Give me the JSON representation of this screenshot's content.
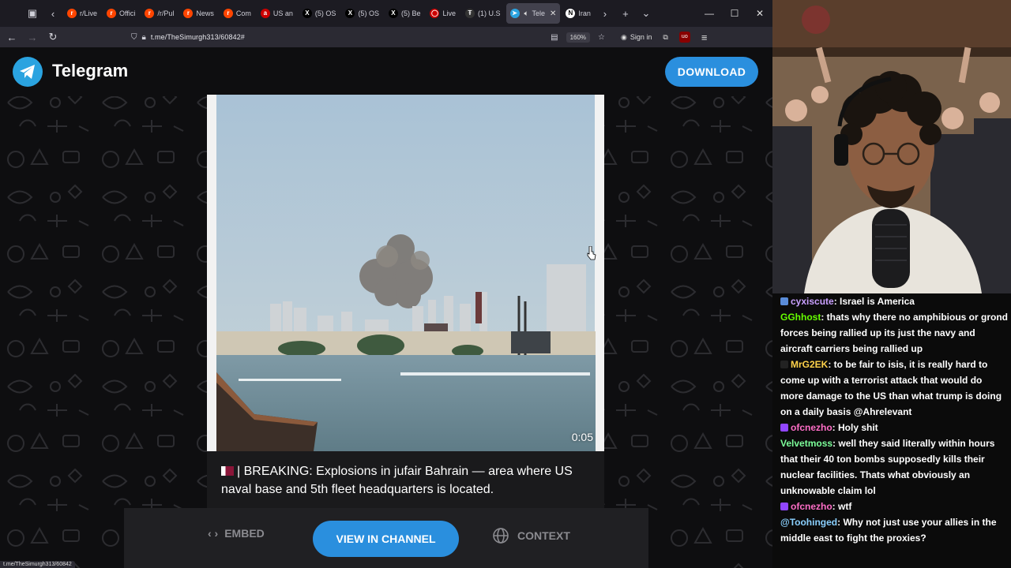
{
  "browser": {
    "tabs": [
      {
        "label": "r/Live",
        "color": "#ff4500",
        "glyph": "r"
      },
      {
        "label": "Offici",
        "color": "#ff4500",
        "glyph": "r"
      },
      {
        "label": "/r/Pul",
        "color": "#ff4500",
        "glyph": "r"
      },
      {
        "label": "News",
        "color": "#ff4500",
        "glyph": "r"
      },
      {
        "label": "Com",
        "color": "#ff4500",
        "glyph": "r"
      },
      {
        "label": "US an",
        "color": "#cc0000",
        "glyph": "a"
      },
      {
        "label": "(5) OS",
        "color": "#000000",
        "glyph": "X"
      },
      {
        "label": "(5) OS",
        "color": "#000000",
        "glyph": "X"
      },
      {
        "label": "(5) Be",
        "color": "#000000",
        "glyph": "X"
      },
      {
        "label": "Live",
        "color": "#cc0000",
        "glyph": "◯"
      },
      {
        "label": "(1) U.S",
        "color": "#333333",
        "glyph": "Ŧ"
      },
      {
        "label": "Tele",
        "color": "#2aa3e0",
        "glyph": "➤",
        "active": true
      },
      {
        "label": "Iran",
        "color": "#ffffff",
        "glyph": "N"
      }
    ],
    "url": "t.me/TheSimurgh313/60842#",
    "zoom": "160%",
    "sign_in": "Sign in",
    "status_url": "t.me/TheSimurgh313/60842"
  },
  "telegram": {
    "title": "Telegram",
    "download_label": "DOWNLOAD",
    "video_duration": "0:05",
    "post_text": "| BREAKING: Explosions in jufair Bahrain — area where US naval base and 5th fleet headquarters is located.",
    "embed_label": "EMBED",
    "view_channel_label": "VIEW IN CHANNEL",
    "context_label": "CONTEXT"
  },
  "chat": {
    "messages": [
      {
        "user": "cyxiscute",
        "color": "#c9a0ff",
        "badge": "#5a8cd8",
        "text": ": Israel is America"
      },
      {
        "user": "GGhhost",
        "color": "#66ff00",
        "badge": "",
        "text": ": thats why there no amphibious or grond forces being rallied up its just the navy and aircraft carriers being rallied up"
      },
      {
        "user": "MrG2EK",
        "color": "#ffd24a",
        "badge": "#222222",
        "text": ": to be fair to isis, it is really hard to come up with a terrorist attack that would do more damage to the US than what trump is doing on a daily basis @Ahrelevant"
      },
      {
        "user": "ofcnezho",
        "color": "#ff6ec7",
        "badge": "#9146ff",
        "text": ": Holy shit"
      },
      {
        "user": "Velvetmoss",
        "color": "#7cff9a",
        "badge": "",
        "text": ": well they said literally within hours that their 40 ton bombs supposedly kills their nuclear facilities. Thats what obviously an unknowable claim lol"
      },
      {
        "user": "ofcnezho",
        "color": "#ff6ec7",
        "badge": "#9146ff",
        "text": ": wtf"
      },
      {
        "user": "@Toohinged",
        "color": "#8ad0ff",
        "badge": "",
        "text": ": Why not just use your allies in the middle east to fight the proxies?"
      }
    ]
  },
  "colors": {
    "telegram_blue": "#2a8fde",
    "page_bg": "#0e0e10"
  }
}
